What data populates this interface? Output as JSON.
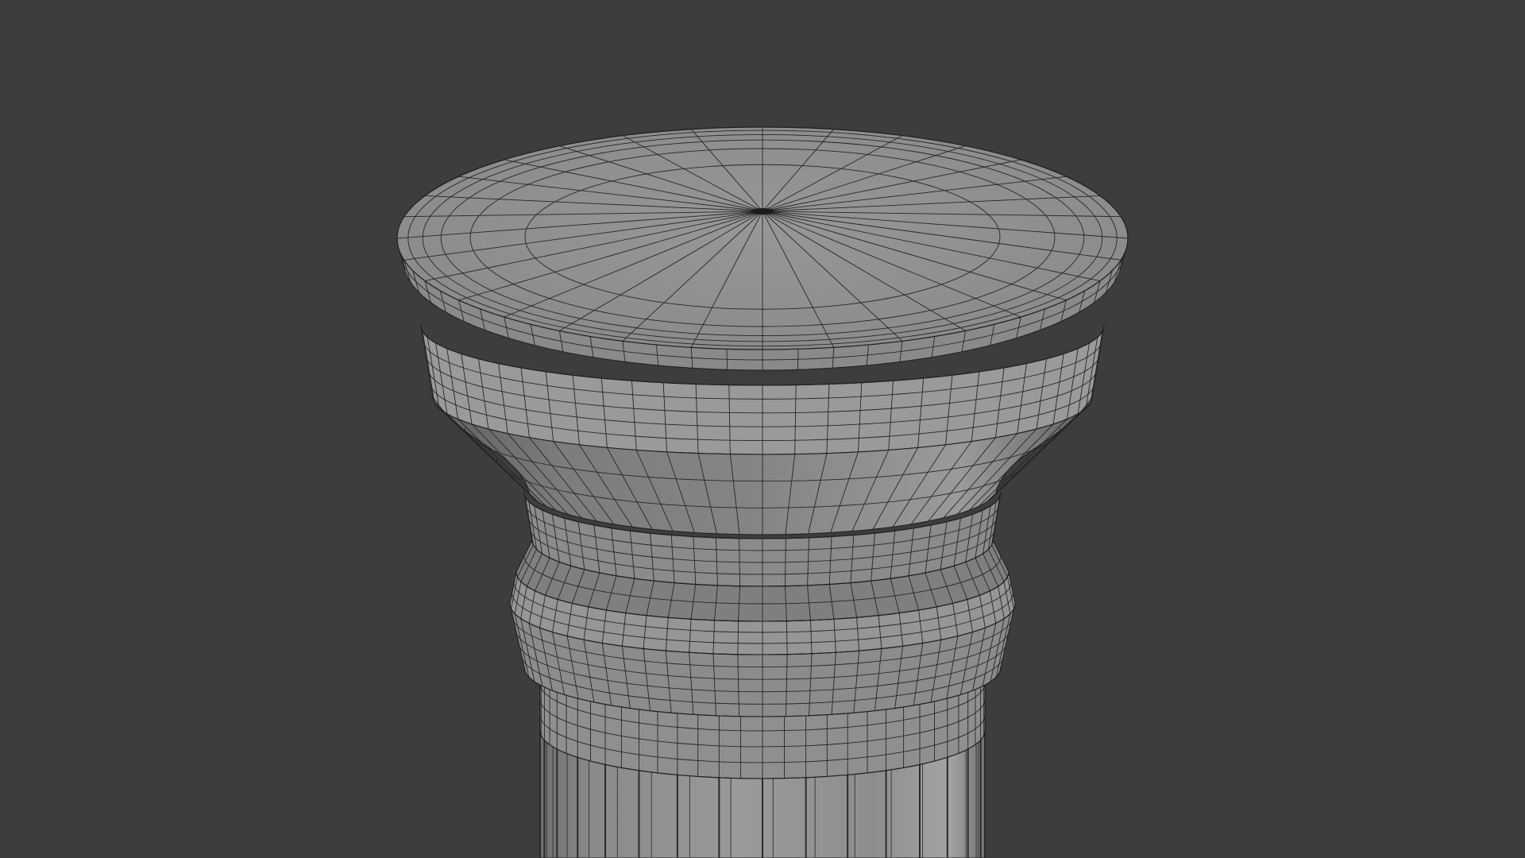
{
  "viewport": {
    "background": "#3d3d3d",
    "object": "column-capital-mesh",
    "display_mode": "solid-with-wireframe",
    "mesh_color": "#8a8a8a",
    "wire_color": "#1e1e1e",
    "cap_radial_segments": 32,
    "shaft_flutes": 16
  }
}
